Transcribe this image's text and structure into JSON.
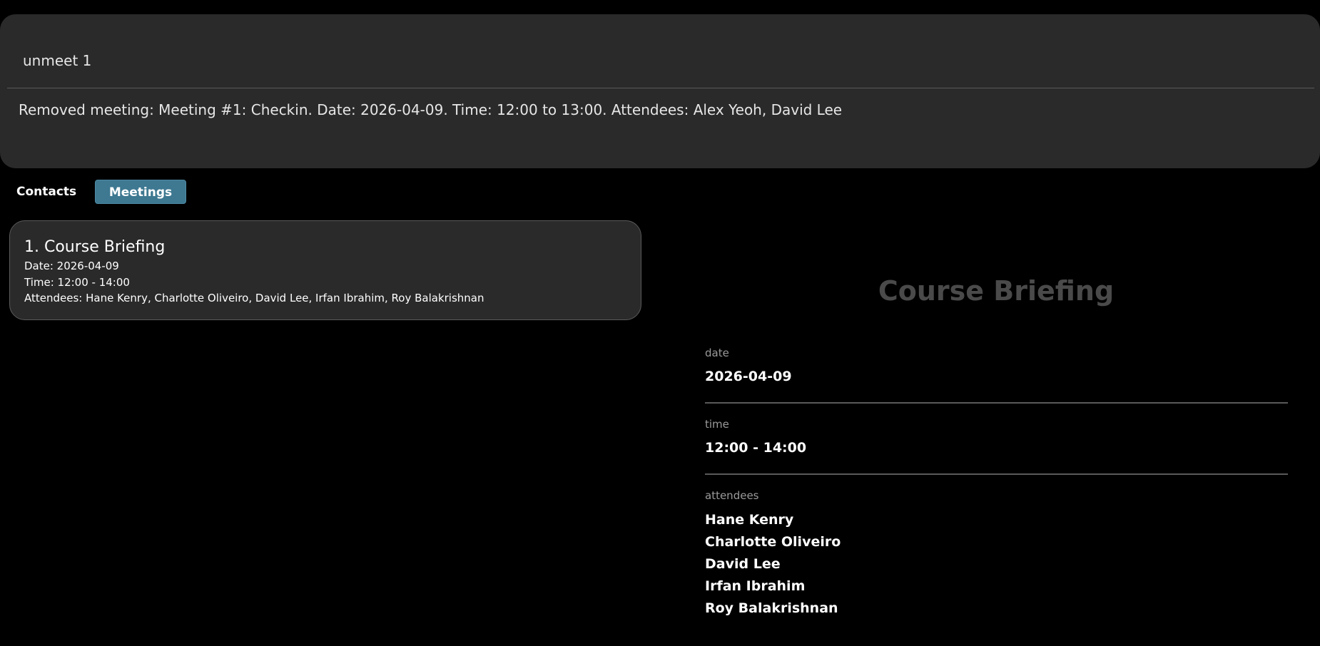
{
  "command": {
    "input_value": "unmeet 1",
    "result": "Removed meeting: Meeting #1: Checkin. Date: 2026-04-09. Time: 12:00 to 13:00. Attendees: Alex Yeoh, David Lee"
  },
  "tabs": {
    "contacts": "Contacts",
    "meetings": "Meetings",
    "active": "Meetings",
    "active_color": "#3e7891"
  },
  "meeting_list": [
    {
      "title": "1.  Course Briefing",
      "date": "Date: 2026-04-09",
      "time": "Time: 12:00 - 14:00",
      "attendees": "Attendees: Hane Kenry, Charlotte Oliveiro, David Lee, Irfan Ibrahim, Roy Balakrishnan"
    }
  ],
  "detail": {
    "title": "Course Briefing",
    "date_label": "date",
    "date_value": "2026-04-09",
    "time_label": "time",
    "time_value": "12:00 - 14:00",
    "attendees_label": "attendees",
    "attendees": [
      "Hane Kenry",
      "Charlotte Oliveiro",
      "David Lee",
      "Irfan Ibrahim",
      "Roy Balakrishnan"
    ]
  }
}
